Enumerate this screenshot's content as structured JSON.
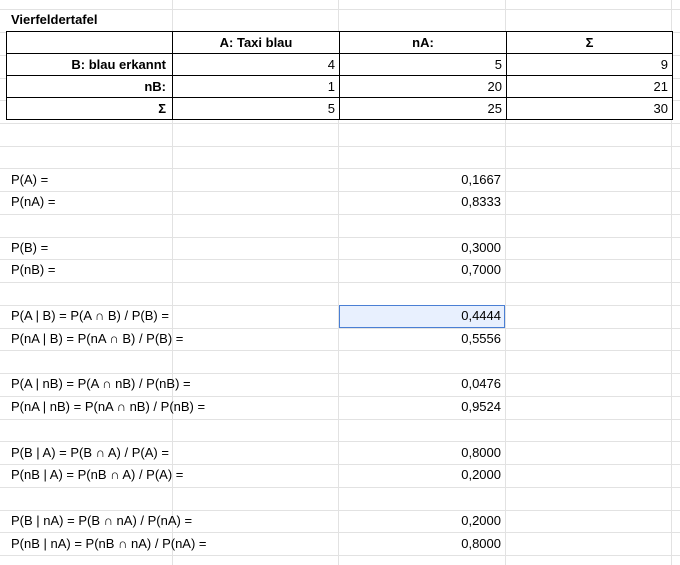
{
  "title": "Vierfeldertafel",
  "table": {
    "headers": [
      "",
      "A: Taxi blau",
      "nA:",
      "Σ"
    ],
    "rows": [
      {
        "label": "B: blau erkannt",
        "cells": [
          "4",
          "5",
          "9"
        ]
      },
      {
        "label": "nB:",
        "cells": [
          "1",
          "20",
          "21"
        ]
      },
      {
        "label": "Σ",
        "cells": [
          "5",
          "25",
          "30"
        ]
      }
    ]
  },
  "formulas": [
    {
      "label": "P(A) =",
      "value": "0,1667"
    },
    {
      "label": "P(nA) =",
      "value": "0,8333"
    },
    {
      "label": "P(B) =",
      "value": "0,3000"
    },
    {
      "label": "P(nB) =",
      "value": "0,7000"
    },
    {
      "label": "P(A | B) = P(A ∩ B) / P(B) =",
      "value": "0,4444"
    },
    {
      "label": "P(nA | B) = P(nA ∩ B) / P(B) =",
      "value": "0,5556"
    },
    {
      "label": "P(A | nB) = P(A ∩ nB) / P(nB) =",
      "value": "0,0476"
    },
    {
      "label": "P(nA | nB) = P(nA ∩ nB) / P(nB) =",
      "value": "0,9524"
    },
    {
      "label": "P(B | A) = P(B ∩ A) / P(A) =",
      "value": "0,8000"
    },
    {
      "label": "P(nB | A) = P(nB ∩ A) / P(A) =",
      "value": "0,2000"
    },
    {
      "label": "P(B | nA) = P(B ∩ nA) / P(nA) =",
      "value": "0,2000"
    },
    {
      "label": "P(nB | nA) = P(nB ∩ nA) / P(nA) =",
      "value": "0,8000"
    }
  ],
  "selected_cell_value": "0,4444"
}
